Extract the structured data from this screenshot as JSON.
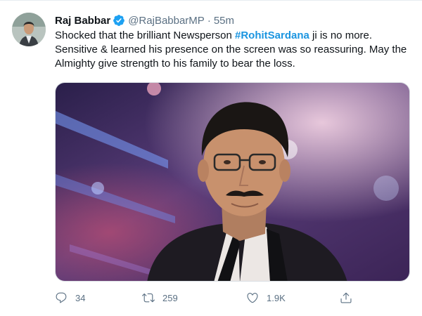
{
  "tweet": {
    "author_name": "Raj Babbar",
    "author_handle": "@RajBabbarMP",
    "separator": "·",
    "time": "55m",
    "text_before": "Shocked that the brilliant Newsperson ",
    "hashtag": "#RohitSardana",
    "text_after": " ji is no more. Sensitive & learned his presence on the screen was so reassuring. May the Almighty give strength to his family to bear the loss.",
    "replies": "34",
    "retweets": "259",
    "likes": "1.9K"
  },
  "icons": {
    "verified": "verified-badge-icon",
    "reply": "reply-icon",
    "retweet": "retweet-icon",
    "like": "heart-icon",
    "share": "share-icon"
  },
  "colors": {
    "hashtag": "#1b95e0",
    "verified": "#1da1f2",
    "secondary_text": "#5b7083"
  }
}
